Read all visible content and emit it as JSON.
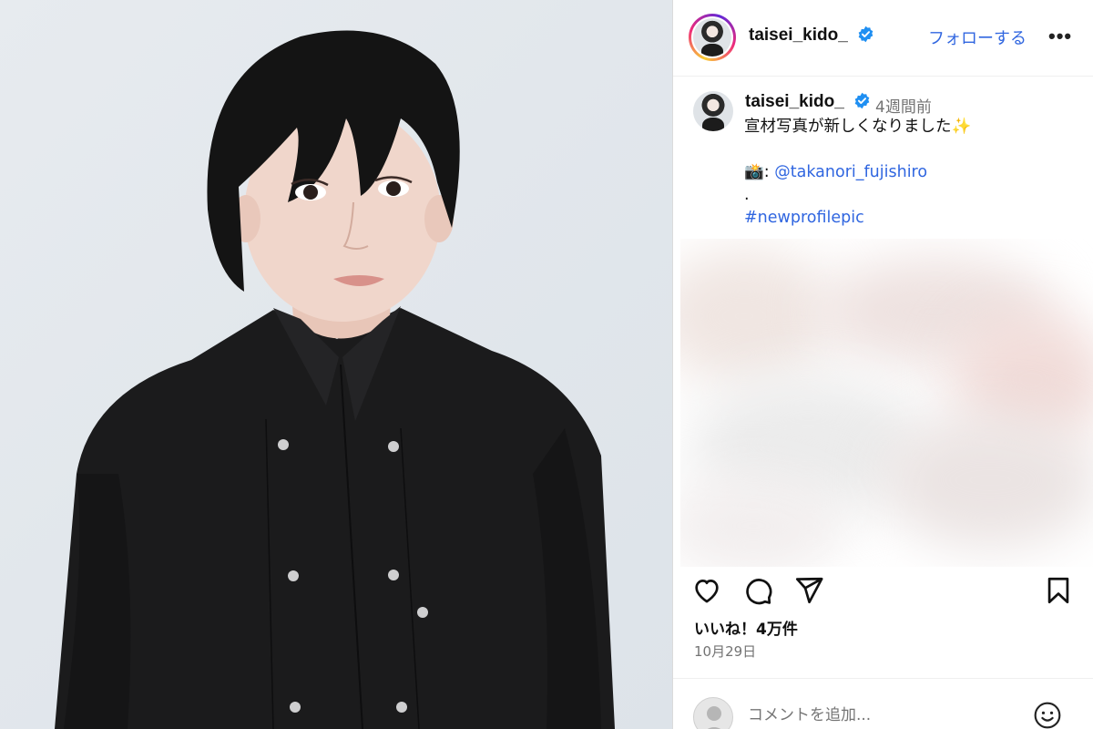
{
  "header": {
    "username": "taisei_kido_",
    "follow_label": "フォローする",
    "more_label": "•••"
  },
  "caption": {
    "username": "taisei_kido_",
    "time": "4週間前",
    "line1": "宣材写真が新しくなりました✨",
    "camera_emoji": "📸",
    "camera_sep": ": ",
    "mention": "@takanori_fujishiro",
    "dot": ".",
    "hashtag": "#newprofilepic"
  },
  "stats": {
    "likes": "いいね！4万件",
    "date": "10月29日"
  },
  "comment": {
    "placeholder": "コメントを追加..."
  },
  "icons": {
    "verified": "verified-badge-icon",
    "like": "heart-icon",
    "comment": "comment-bubble-icon",
    "share": "send-icon",
    "save": "bookmark-icon",
    "emoji": "emoji-smile-icon"
  },
  "colors": {
    "link": "#3066e0",
    "verified": "#1f8ff2",
    "muted": "#737373",
    "shirt": "#1b1b1c",
    "backdrop": "#e3e8ed"
  }
}
